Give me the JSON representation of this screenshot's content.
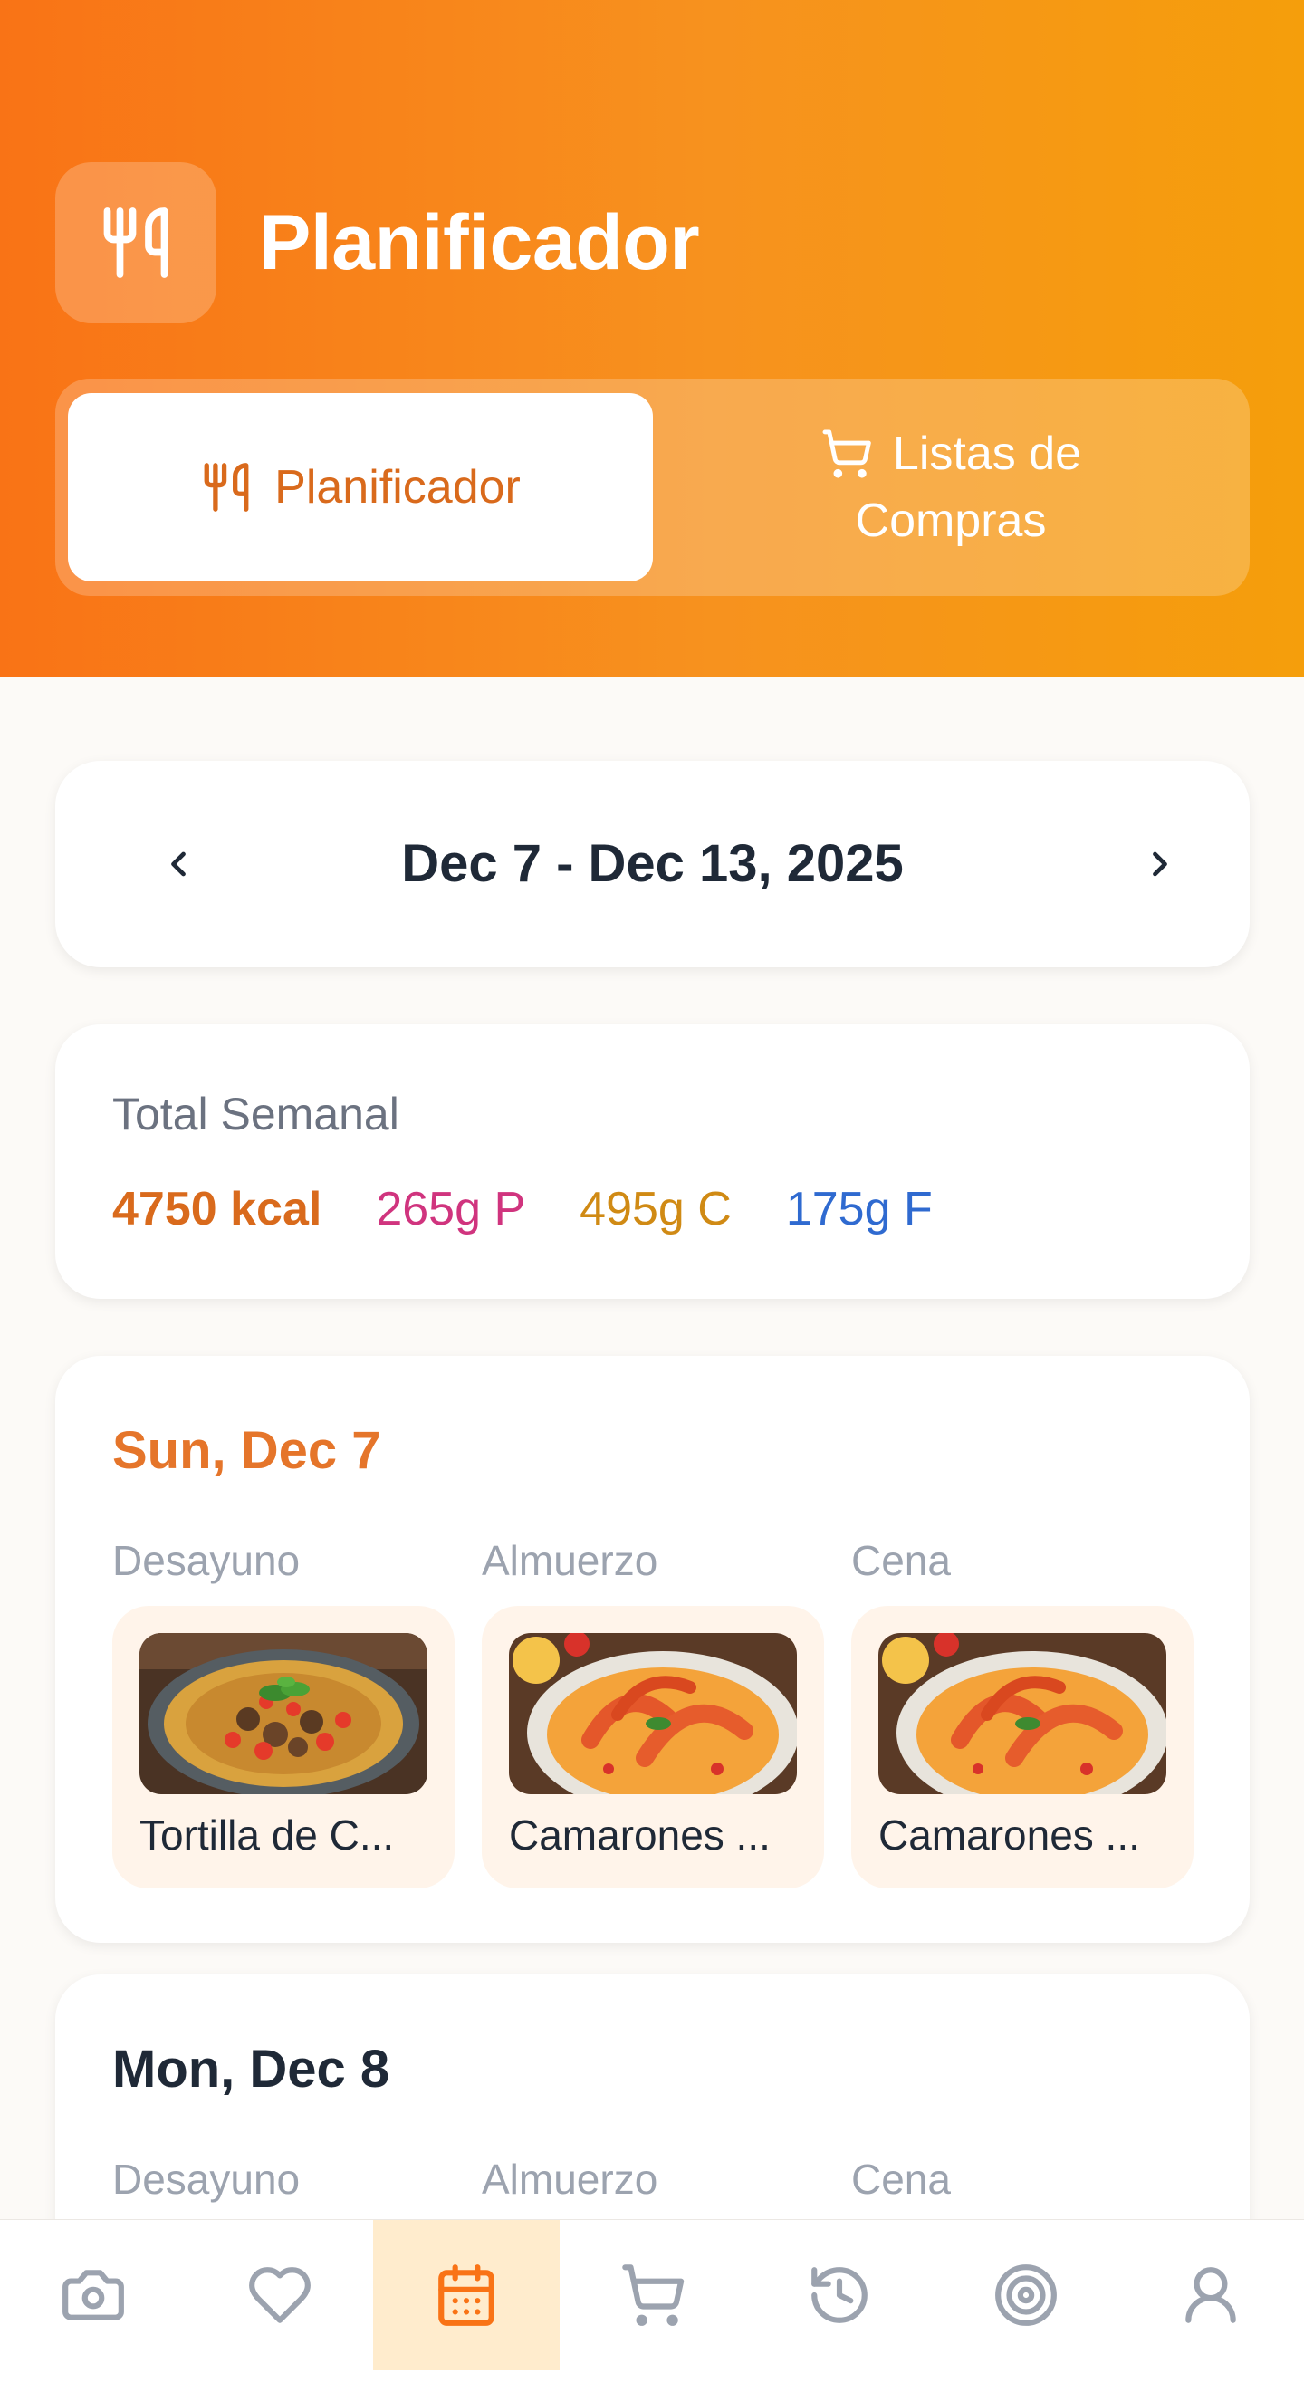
{
  "header": {
    "title": "Planificador",
    "tabs": [
      {
        "label": "Planificador",
        "active": true
      },
      {
        "label_line1": "Listas de",
        "label_line2": "Compras",
        "active": false
      }
    ]
  },
  "week": {
    "label": "Dec 7 - Dec 13, 2025"
  },
  "totals": {
    "title": "Total Semanal",
    "kcal": "4750 kcal",
    "protein": "265g P",
    "carbs": "495g C",
    "fat": "175g F"
  },
  "days": [
    {
      "title": "Sun, Dec 7",
      "meals": [
        {
          "type": "Desayuno",
          "name": "Tortilla de C..."
        },
        {
          "type": "Almuerzo",
          "name": "Camarones ..."
        },
        {
          "type": "Cena",
          "name": "Camarones ..."
        }
      ]
    },
    {
      "title": "Mon, Dec 8",
      "meals": [
        {
          "type": "Desayuno"
        },
        {
          "type": "Almuerzo"
        },
        {
          "type": "Cena"
        }
      ]
    }
  ],
  "nav": [
    {
      "icon": "camera-icon"
    },
    {
      "icon": "heart-icon"
    },
    {
      "icon": "calendar-icon",
      "active": true
    },
    {
      "icon": "cart-icon"
    },
    {
      "icon": "history-icon"
    },
    {
      "icon": "target-icon"
    },
    {
      "icon": "user-icon"
    }
  ],
  "colors": {
    "accent": "#e5752a",
    "header_start": "#f97316",
    "header_end": "#f59e0b",
    "protein": "#d0347e",
    "carbs": "#d08a14",
    "fat": "#2f6ad0"
  }
}
